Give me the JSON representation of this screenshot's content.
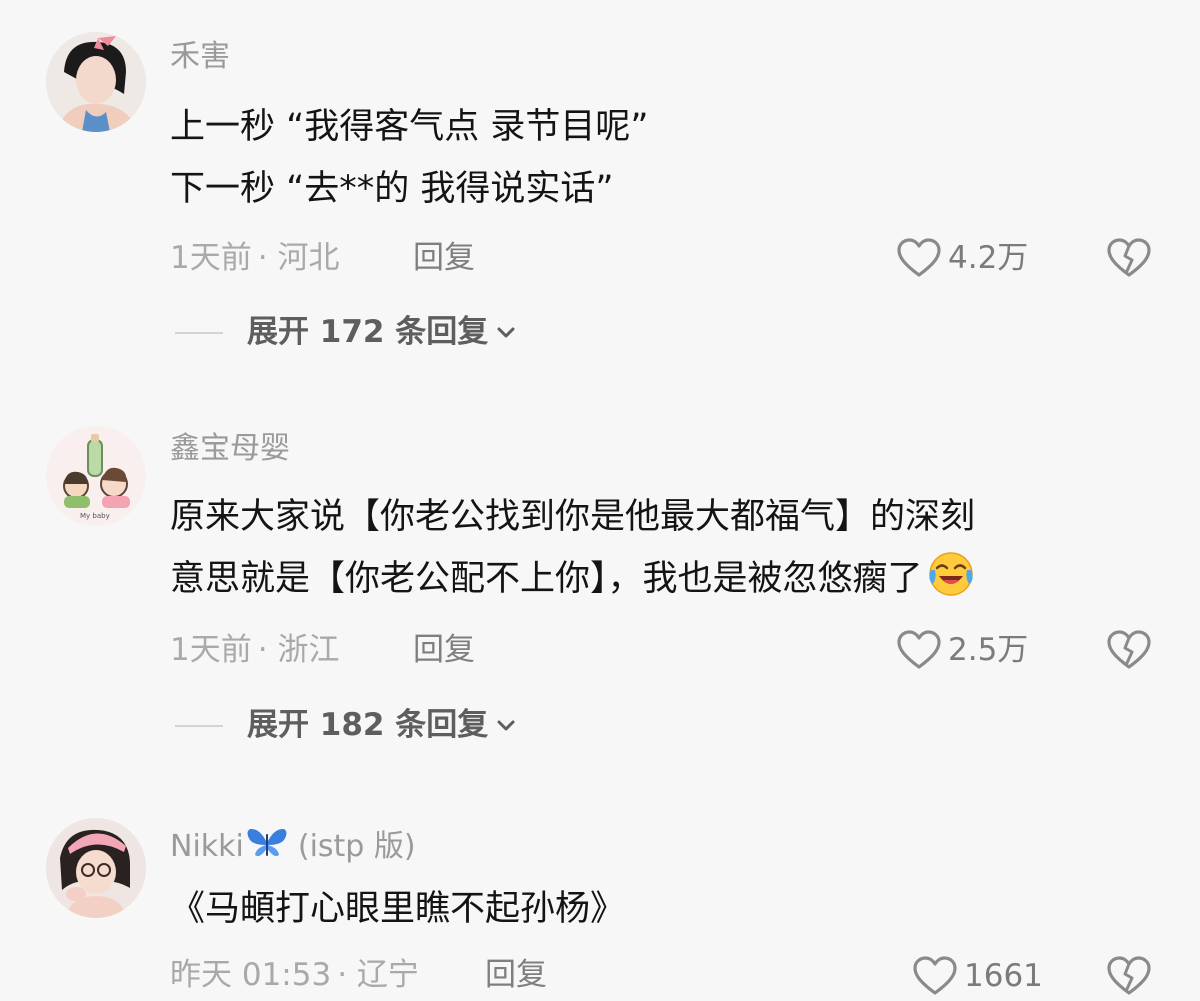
{
  "comments": [
    {
      "username": "禾害",
      "lines": [
        "上一秒 “我得客气点  录节目呢”",
        "下一秒 “去**的  我得说实话”"
      ],
      "time": "1天前",
      "location": "· 河北",
      "reply_label": "回复",
      "likes": "4.2万",
      "expand_label": "展开 172 条回复"
    },
    {
      "username": "鑫宝母婴",
      "lines": [
        "原来大家说【你老公找到你是他最大都福气】的深刻",
        "意思就是【你老公配不上你】，我也是被忽悠瘸了"
      ],
      "emoji": "laughing-crying-emoji",
      "avatar_text": "My baby",
      "time": "1天前",
      "location": "· 浙江",
      "reply_label": "回复",
      "likes": "2.5万",
      "expand_label": "展开 182 条回复"
    },
    {
      "username": "Nikki",
      "username_icon": "butterfly-icon",
      "username_suffix": "(istp 版)",
      "lines": [
        "《马頔打心眼里瞧不起孙杨》"
      ],
      "time": "昨天 01:53",
      "location": "· 辽宁",
      "reply_label": "回复",
      "likes": "1661"
    }
  ],
  "colors": {
    "background": "#f7f7f7",
    "text": "#141414",
    "muted": "#a9a9a9",
    "icon": "#8a8a8a",
    "butterfly": "#3a7fe0"
  }
}
